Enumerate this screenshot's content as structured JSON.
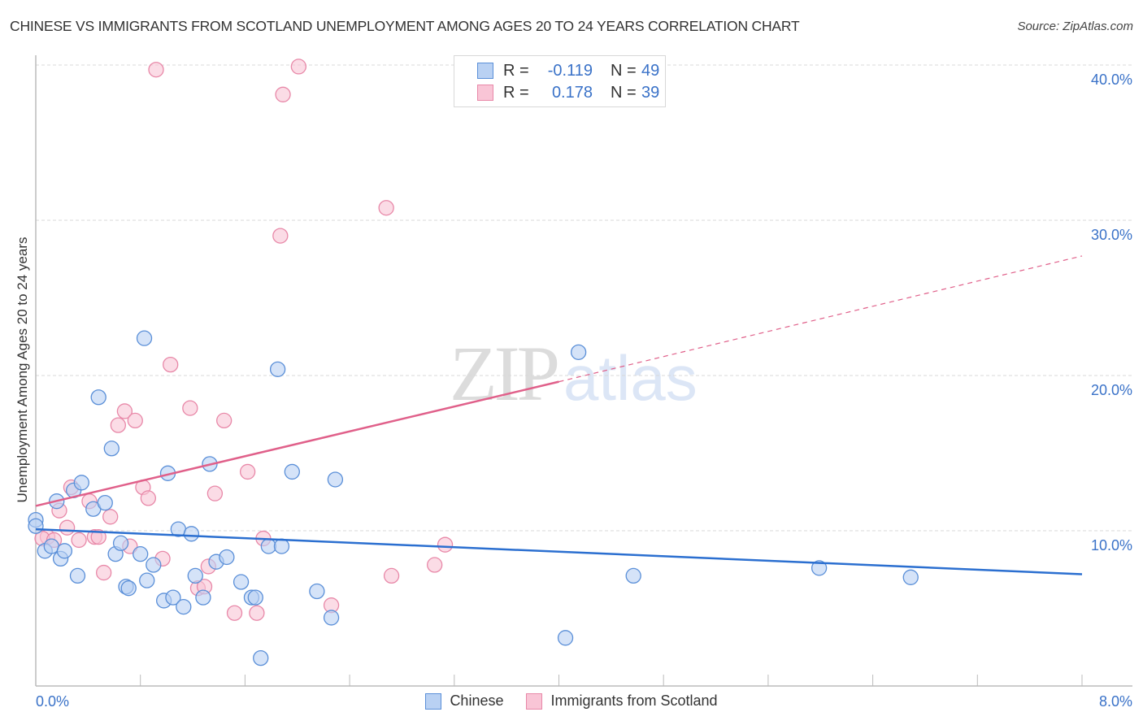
{
  "title": "CHINESE VS IMMIGRANTS FROM SCOTLAND UNEMPLOYMENT AMONG AGES 20 TO 24 YEARS CORRELATION CHART",
  "source": "Source: ZipAtlas.com",
  "watermark": {
    "zip": "ZIP",
    "atlas": "atlas"
  },
  "colors": {
    "chinese_fill": "#b9d1f3",
    "chinese_stroke": "#5a8fd8",
    "chinese_line": "#2b6fd0",
    "scotland_fill": "#f9c5d6",
    "scotland_stroke": "#e888a8",
    "scotland_line": "#e0608a",
    "axis_label": "#3a72c8"
  },
  "legend": {
    "rows": [
      {
        "r_label": "R =",
        "r_value": "-0.119",
        "n_label": "N =",
        "n_value": "49"
      },
      {
        "r_label": "R =",
        "r_value": "0.178",
        "n_label": "N =",
        "n_value": "39"
      }
    ]
  },
  "chart_data": {
    "type": "scatter",
    "title": "CHINESE VS IMMIGRANTS FROM SCOTLAND UNEMPLOYMENT AMONG AGES 20 TO 24 YEARS CORRELATION CHART",
    "xlabel": "",
    "ylabel": "Unemployment Among Ages 20 to 24 years",
    "xlim": [
      0,
      8
    ],
    "ylim": [
      0,
      42
    ],
    "x_tick_labels": [
      "0.0%",
      "8.0%"
    ],
    "x_minor_ticks": [
      0,
      0.8,
      1.6,
      2.4,
      3.2,
      4.0,
      4.8,
      5.6,
      6.4,
      7.2,
      8.0
    ],
    "y_ticks": [
      10,
      20,
      30,
      40
    ],
    "y_tick_labels": [
      "10.0%",
      "20.0%",
      "30.0%",
      "40.0%"
    ],
    "grid": "horizontal-dashed",
    "legend_position": "top-center",
    "series": [
      {
        "name": "Chinese",
        "R": -0.119,
        "N": 49,
        "trend": {
          "x": [
            0,
            8
          ],
          "y": [
            10.1,
            7.2
          ],
          "style": "solid"
        },
        "points": [
          [
            0.0,
            10.7
          ],
          [
            0.07,
            8.7
          ],
          [
            0.12,
            9.0
          ],
          [
            0.16,
            11.9
          ],
          [
            0.19,
            8.2
          ],
          [
            0.22,
            8.7
          ],
          [
            0.29,
            12.6
          ],
          [
            0.32,
            7.1
          ],
          [
            0.35,
            13.1
          ],
          [
            0.44,
            11.4
          ],
          [
            0.53,
            11.8
          ],
          [
            0.48,
            18.6
          ],
          [
            0.58,
            15.3
          ],
          [
            0.61,
            8.5
          ],
          [
            0.65,
            9.2
          ],
          [
            0.69,
            6.4
          ],
          [
            0.71,
            6.3
          ],
          [
            0.8,
            8.5
          ],
          [
            0.83,
            22.4
          ],
          [
            0.85,
            6.8
          ],
          [
            0.9,
            7.8
          ],
          [
            0.98,
            5.5
          ],
          [
            1.01,
            13.7
          ],
          [
            1.05,
            5.7
          ],
          [
            1.09,
            10.1
          ],
          [
            1.13,
            5.1
          ],
          [
            1.19,
            9.8
          ],
          [
            1.22,
            7.1
          ],
          [
            1.28,
            5.7
          ],
          [
            1.33,
            14.3
          ],
          [
            1.38,
            8.0
          ],
          [
            1.46,
            8.3
          ],
          [
            1.57,
            6.7
          ],
          [
            1.65,
            5.7
          ],
          [
            1.68,
            5.7
          ],
          [
            1.72,
            1.8
          ],
          [
            1.85,
            20.4
          ],
          [
            1.78,
            9.0
          ],
          [
            1.88,
            9.0
          ],
          [
            1.96,
            13.8
          ],
          [
            2.15,
            6.1
          ],
          [
            2.26,
            4.4
          ],
          [
            2.29,
            13.3
          ],
          [
            4.15,
            21.5
          ],
          [
            4.05,
            3.1
          ],
          [
            4.57,
            7.1
          ],
          [
            5.99,
            7.6
          ],
          [
            6.69,
            7.0
          ],
          [
            0.0,
            10.3
          ]
        ]
      },
      {
        "name": "Immigrants from Scotland",
        "R": 0.178,
        "N": 39,
        "trend": {
          "x": [
            0,
            4.0
          ],
          "y": [
            11.6,
            19.6
          ],
          "style": "solid",
          "extension": {
            "x": [
              4.0,
              8
            ],
            "y": [
              19.6,
              27.7
            ],
            "style": "dashed"
          }
        },
        "points": [
          [
            0.92,
            39.7
          ],
          [
            2.01,
            39.9
          ],
          [
            1.89,
            38.1
          ],
          [
            2.68,
            30.8
          ],
          [
            1.87,
            29.0
          ],
          [
            1.03,
            20.7
          ],
          [
            1.18,
            17.9
          ],
          [
            0.68,
            17.7
          ],
          [
            0.63,
            16.8
          ],
          [
            0.76,
            17.1
          ],
          [
            1.44,
            17.1
          ],
          [
            1.62,
            13.8
          ],
          [
            0.82,
            12.8
          ],
          [
            0.86,
            12.1
          ],
          [
            0.27,
            12.8
          ],
          [
            0.18,
            11.3
          ],
          [
            0.41,
            11.9
          ],
          [
            0.57,
            10.9
          ],
          [
            0.24,
            10.2
          ],
          [
            0.09,
            9.6
          ],
          [
            0.05,
            9.5
          ],
          [
            0.14,
            9.4
          ],
          [
            0.33,
            9.4
          ],
          [
            0.45,
            9.6
          ],
          [
            0.48,
            9.6
          ],
          [
            0.52,
            7.3
          ],
          [
            0.72,
            9.0
          ],
          [
            0.97,
            8.2
          ],
          [
            1.32,
            7.7
          ],
          [
            1.37,
            12.4
          ],
          [
            1.24,
            6.3
          ],
          [
            1.29,
            6.4
          ],
          [
            1.74,
            9.5
          ],
          [
            1.52,
            4.7
          ],
          [
            1.69,
            4.7
          ],
          [
            2.26,
            5.2
          ],
          [
            2.72,
            7.1
          ],
          [
            3.05,
            7.8
          ],
          [
            3.13,
            9.1
          ]
        ]
      }
    ]
  },
  "bottom_legend": [
    {
      "label": "Chinese"
    },
    {
      "label": "Immigrants from Scotland"
    }
  ]
}
